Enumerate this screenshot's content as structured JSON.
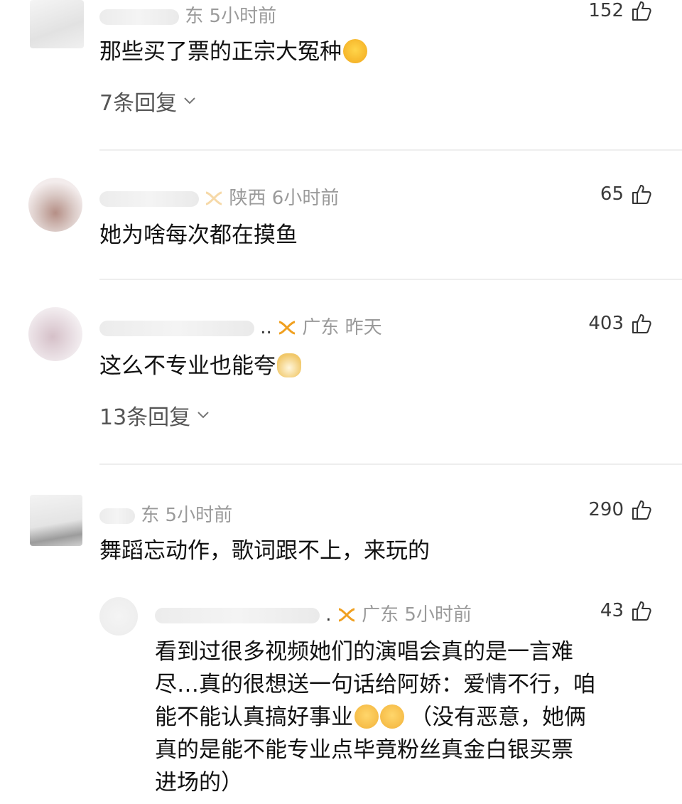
{
  "comments": [
    {
      "region": "东 5小时前",
      "likes": "152",
      "text": "那些买了票的正宗大冤种",
      "emoji": "laughing-crying-emoji",
      "replies": "7条回复"
    },
    {
      "region": "陕西 6小时前",
      "likes": "65",
      "text": "她为啥每次都在摸鱼"
    },
    {
      "prefix": "..",
      "region": "广东 昨天",
      "likes": "403",
      "text": "这么不专业也能夸",
      "emoji": "doge-emoji",
      "replies": "13条回复"
    },
    {
      "region": "东 5小时前",
      "likes": "290",
      "text": "舞蹈忘动作，歌词跟不上，来玩的"
    },
    {
      "prefix": ".",
      "region": "广东 5小时前",
      "likes": "43",
      "text_lines": [
        "看到过很多视频她们的演唱会真的是一言难",
        "尽…真的很想送一句话给阿娇：爱情不行，咱",
        "能不能认真搞好事业",
        "（没有恶意，她俩",
        "真的是能不能专业点毕竟粉丝真金白银买票",
        "进场的）"
      ],
      "emoji": "sneeze-emoji"
    }
  ],
  "colors": {
    "meta": "#9a9a9a",
    "vip": "#f0a020",
    "divider": "#eeeeee"
  }
}
